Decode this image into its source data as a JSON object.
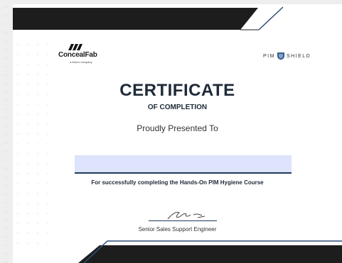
{
  "certificate": {
    "logo_left": {
      "name": "ConcealFab",
      "tagline": "a Mavrx company"
    },
    "logo_right": {
      "prefix": "PIM",
      "suffix": "SHIELD"
    },
    "title": "CERTIFICATE",
    "subtitle": "OF COMPLETION",
    "presented": "Proudly Presented To",
    "recipient_name": "",
    "completion_text": "For successfully completing the Hands-On PIM Hygiene Course",
    "signer_title": "Senior Sales Support Engineer"
  },
  "colors": {
    "dark_band": "#1d1d1d",
    "accent_blue": "#2f4f7a",
    "name_fill": "#dde4fb"
  }
}
